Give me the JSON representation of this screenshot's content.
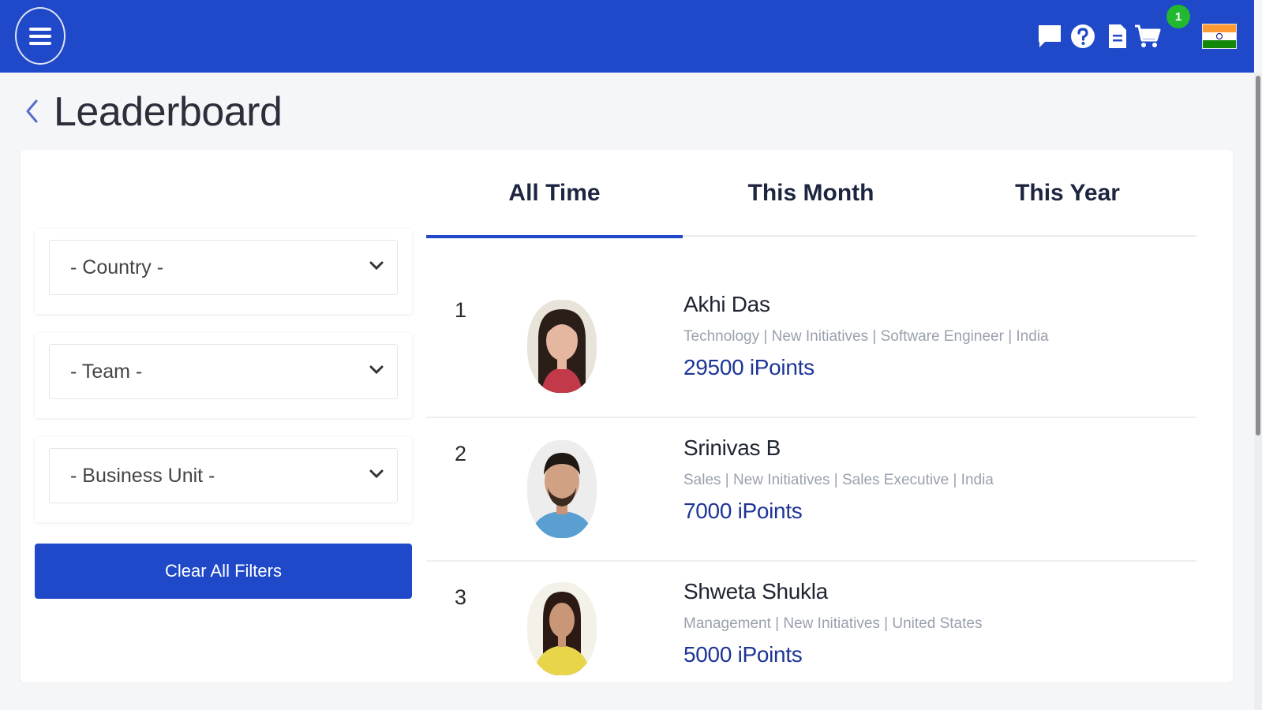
{
  "header": {
    "menu_icon": "hamburger-menu-icon",
    "icons": [
      "chat-icon",
      "help-icon",
      "document-icon",
      "cart-icon"
    ],
    "cart_badge": "1",
    "flag": "india-flag-icon",
    "bg_color": "#1f49c8"
  },
  "page": {
    "title": "Leaderboard"
  },
  "filters": {
    "country_placeholder": "- Country -",
    "team_placeholder": "- Team -",
    "business_unit_placeholder": "- Business Unit -",
    "clear_label": "Clear All Filters"
  },
  "tabs": [
    {
      "label": "All Time",
      "active": true
    },
    {
      "label": "This Month",
      "active": false
    },
    {
      "label": "This Year",
      "active": false
    }
  ],
  "leaders": [
    {
      "rank": "1",
      "name": "Akhi Das",
      "meta": "Technology | New Initiatives | Software Engineer | India",
      "points": "29500 iPoints"
    },
    {
      "rank": "2",
      "name": "Srinivas B",
      "meta": "Sales | New Initiatives | Sales Executive | India",
      "points": "7000 iPoints"
    },
    {
      "rank": "3",
      "name": "Shweta Shukla",
      "meta": "Management | New Initiatives | United States",
      "points": "5000 iPoints"
    }
  ]
}
